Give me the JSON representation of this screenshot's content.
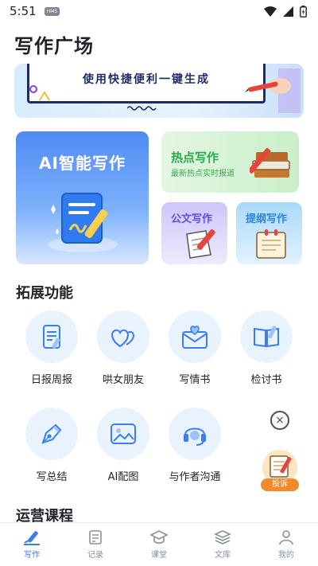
{
  "status_bar": {
    "time": "5:51",
    "badge": "HMS"
  },
  "page_title": "写作广场",
  "banner": {
    "slogan": "使用快捷便利一键生成"
  },
  "cards": {
    "ai_writing": {
      "title": "AI智能写作"
    },
    "hot_writing": {
      "title": "热点写作",
      "subtitle": "最新热点实时报道"
    },
    "official_writing": {
      "title": "公文写作"
    },
    "outline_writing": {
      "title": "提纲写作"
    }
  },
  "extensions": {
    "title": "拓展功能",
    "items": [
      {
        "label": "日报周报",
        "icon": "report-icon"
      },
      {
        "label": "哄女朋友",
        "icon": "hearts-icon"
      },
      {
        "label": "写情书",
        "icon": "love-letter-icon"
      },
      {
        "label": "检讨书",
        "icon": "book-pen-icon"
      },
      {
        "label": "写总结",
        "icon": "fountain-pen-icon"
      },
      {
        "label": "AI配图",
        "icon": "image-icon"
      },
      {
        "label": "与作者沟通",
        "icon": "headset-icon"
      }
    ]
  },
  "operations": {
    "title": "运营课程"
  },
  "floating": {
    "complain_label": "投诉",
    "close_symbol": "×"
  },
  "nav": {
    "items": [
      {
        "label": "写作",
        "icon": "write-icon",
        "active": true
      },
      {
        "label": "记录",
        "icon": "record-icon",
        "active": false
      },
      {
        "label": "课堂",
        "icon": "classroom-icon",
        "active": false
      },
      {
        "label": "文库",
        "icon": "library-icon",
        "active": false
      },
      {
        "label": "我的",
        "icon": "profile-icon",
        "active": false
      }
    ]
  },
  "colors": {
    "accent": "#3a7df5",
    "hot_green": "#2aa84a",
    "doc_purple": "#6a4be0",
    "outline_blue": "#2a83e0",
    "complain_orange": "#f08a2c",
    "icon_bg": "#e9f3fe"
  }
}
